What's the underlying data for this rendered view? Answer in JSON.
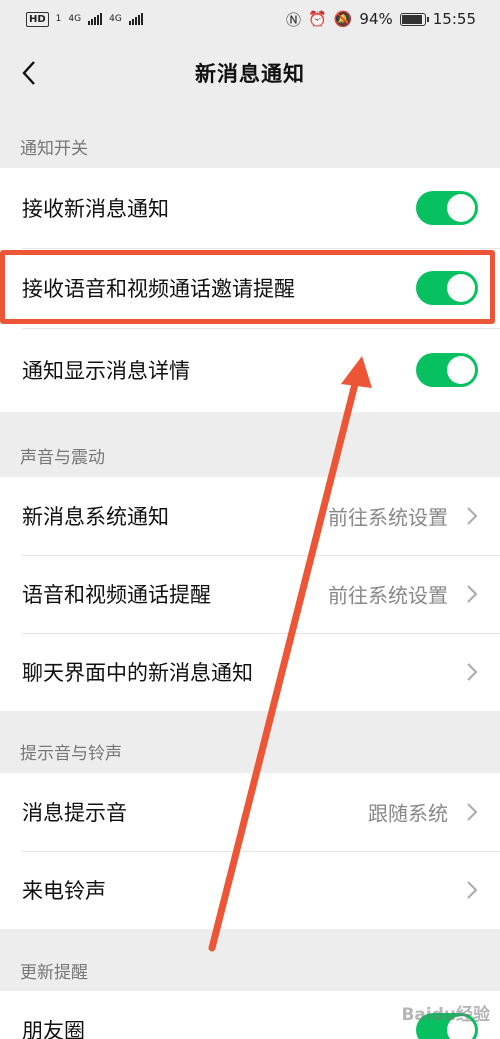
{
  "status_bar": {
    "hd": "HD",
    "sim1": "1",
    "net1": "4G",
    "net2": "4G",
    "battery": "94%",
    "time": "15:55"
  },
  "nav": {
    "title": "新消息通知",
    "back_icon": "chevron-left-icon"
  },
  "sections": {
    "notify_switch": {
      "label": "通知开关",
      "items": [
        {
          "label": "接收新消息通知",
          "on": true
        },
        {
          "label": "接收语音和视频通话邀请提醒",
          "on": true
        },
        {
          "label": "通知显示消息详情",
          "on": true
        }
      ]
    },
    "sound_vibration": {
      "label": "声音与震动",
      "items": [
        {
          "label": "新消息系统通知",
          "value": "前往系统设置"
        },
        {
          "label": "语音和视频通话提醒",
          "value": "前往系统设置"
        },
        {
          "label": "聊天界面中的新消息通知",
          "value": ""
        }
      ]
    },
    "tone": {
      "label": "提示音与铃声",
      "items": [
        {
          "label": "消息提示音",
          "value": "跟随系统"
        },
        {
          "label": "来电铃声",
          "value": ""
        }
      ]
    },
    "update": {
      "label": "更新提醒",
      "items": [
        {
          "label": "朋友圈",
          "on": true
        }
      ]
    }
  },
  "colors": {
    "toggle_on": "#07c160",
    "annotation": "#ec5535"
  },
  "watermark": "Baidu经验"
}
